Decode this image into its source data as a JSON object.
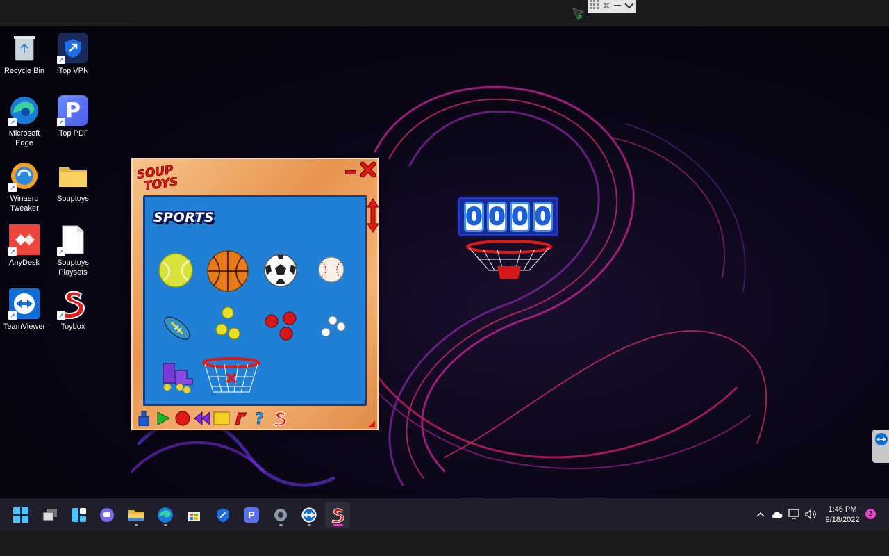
{
  "desktop_icons": [
    {
      "label": "Recycle Bin",
      "icon": "recycle-bin-icon"
    },
    {
      "label": "iTop VPN",
      "icon": "itop-vpn-icon"
    },
    {
      "label": "Microsoft Edge",
      "icon": "edge-icon"
    },
    {
      "label": "iTop PDF",
      "icon": "itop-pdf-icon"
    },
    {
      "label": "Winaero Tweaker",
      "icon": "winaero-tweaker-icon"
    },
    {
      "label": "Souptoys",
      "icon": "folder-icon"
    },
    {
      "label": "AnyDesk",
      "icon": "anydesk-icon"
    },
    {
      "label": "Souptoys Playsets",
      "icon": "document-icon"
    },
    {
      "label": "TeamViewer",
      "icon": "teamviewer-icon"
    },
    {
      "label": "Toybox",
      "icon": "souptoys-s-icon"
    }
  ],
  "toybox": {
    "logo_line1": "SOUP",
    "logo_line2": "TOYS",
    "category_title": "SPORTS",
    "toys": [
      {
        "name": "tennis-ball-toy"
      },
      {
        "name": "basketball-toy"
      },
      {
        "name": "soccer-ball-toy"
      },
      {
        "name": "baseball-toy"
      },
      {
        "name": "football-toy"
      },
      {
        "name": "yellow-balls-toy"
      },
      {
        "name": "red-balls-toy"
      },
      {
        "name": "white-balls-toy"
      },
      {
        "name": "roller-skates-toy"
      },
      {
        "name": "basketball-hoop-toy"
      }
    ],
    "toolbar": [
      "pin-icon",
      "play-icon",
      "record-icon",
      "rewind-icon",
      "stop-icon",
      "music-icon",
      "help-icon",
      "souptoys-icon"
    ]
  },
  "scoreboard": {
    "digits": [
      "0",
      "0",
      "0",
      "0"
    ]
  },
  "taskbar": {
    "apps": [
      "start-icon",
      "task-view-icon",
      "widgets-icon",
      "chat-icon",
      "file-explorer-icon",
      "edge-icon",
      "store-icon",
      "itop-vpn-icon",
      "itop-pdf-icon",
      "settings-icon",
      "teamviewer-icon",
      "souptoys-icon"
    ],
    "time": "1:46 PM",
    "date": "9/18/2022",
    "notification_count": "2"
  },
  "colors": {
    "panel_blue": "#1f80d6",
    "window_wood": "#e89450",
    "score_blue": "#1a2a9a",
    "accent_pink": "#e545c7"
  }
}
